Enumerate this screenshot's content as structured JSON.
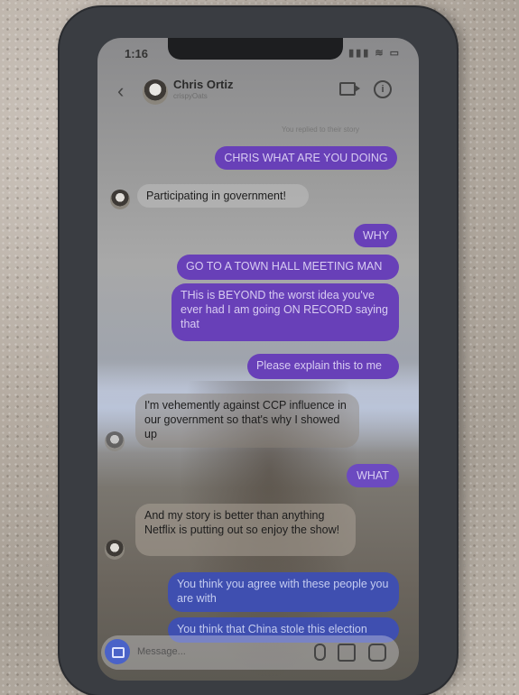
{
  "status": {
    "time": "1:16",
    "icons": "▮▮▮ ≋ ▭"
  },
  "header": {
    "name": "Chris Ortiz",
    "handle": "crispyOats"
  },
  "story_note": "You replied to their story",
  "messages": [
    {
      "dir": "out",
      "text": "CHRIS WHAT ARE YOU DOING"
    },
    {
      "dir": "in",
      "text": "Participating in government!"
    },
    {
      "dir": "out",
      "text": "WHY"
    },
    {
      "dir": "out",
      "text": "GO TO A TOWN HALL MEETING MAN"
    },
    {
      "dir": "out",
      "text": "THis is BEYOND the worst idea you've ever had I am going ON RECORD saying that"
    },
    {
      "dir": "out",
      "text": "Please explain this to me"
    },
    {
      "dir": "in",
      "text": "I'm vehemently against CCP influence in our government so that's why I showed up"
    },
    {
      "dir": "out",
      "text": "WHAT"
    },
    {
      "dir": "in",
      "text": "And my story is better than anything Netflix is putting out so enjoy the show!"
    },
    {
      "dir": "out",
      "text": "You think you agree with these people you are with"
    },
    {
      "dir": "out",
      "text": "You think that China stole this election"
    }
  ],
  "composer": {
    "placeholder": "Message..."
  }
}
